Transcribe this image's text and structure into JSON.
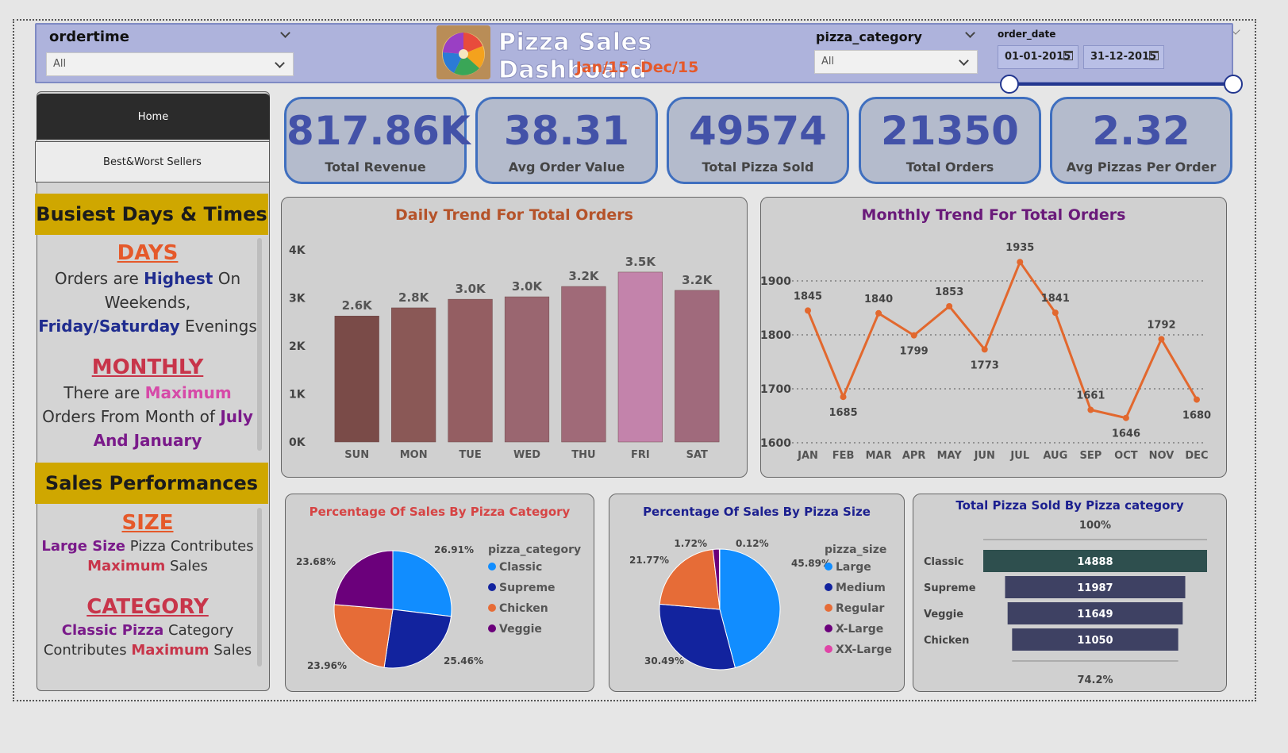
{
  "header": {
    "title": "Pizza Sales Dashboard",
    "subtitle": "Jan/15 -Dec/15",
    "ordertime": {
      "label": "ordertime",
      "value": "All"
    },
    "pizza_category": {
      "label": "pizza_category",
      "value": "All"
    },
    "order_date": {
      "label": "order_date",
      "start": "01-01-2015",
      "end": "31-12-2015"
    }
  },
  "nav": {
    "home": "Home",
    "best_worst": "Best&Worst Sellers"
  },
  "sidebar": {
    "busiest_title": "Busiest Days & Times",
    "days_heading": "DAYS",
    "days_text": {
      "a": "Orders are ",
      "b": "Highest",
      "c": " On Weekends, ",
      "d": "Friday/Saturday",
      "e": " Evenings"
    },
    "monthly_heading": "MONTHLY",
    "monthly_text": {
      "a": "There are ",
      "b": "Maximum",
      "c": " Orders From Month of ",
      "d": "July And January"
    },
    "sales_title": "Sales Performances",
    "size_heading": "SIZE",
    "size_text": {
      "a": "Large Size",
      "b": " Pizza Contributes ",
      "c": "Maximum",
      "d": " Sales"
    },
    "category_heading": "CATEGORY",
    "category_text": {
      "a": "Classic Pizza",
      "b": " Category Contributes ",
      "c": "Maximum",
      "d": " Sales"
    }
  },
  "kpis": [
    {
      "value": "817.86K",
      "label": "Total Revenue"
    },
    {
      "value": "38.31",
      "label": "Avg Order Value"
    },
    {
      "value": "49574",
      "label": "Total Pizza Sold"
    },
    {
      "value": "21350",
      "label": "Total Orders"
    },
    {
      "value": "2.32",
      "label": "Avg Pizzas Per Order"
    }
  ],
  "colors": {
    "accent_blue": "#4352a8",
    "orange": "#e5592a",
    "gold": "#cfa700",
    "line": "#e2682e",
    "daily_title": "#b5532a",
    "monthly_title": "#6a1a7a"
  },
  "chart_data": [
    {
      "type": "bar",
      "title": "Daily Trend For Total Orders",
      "categories": [
        "SUN",
        "MON",
        "TUE",
        "WED",
        "THU",
        "FRI",
        "SAT"
      ],
      "values": [
        2624,
        2794,
        2973,
        3024,
        3239,
        3538,
        3158
      ],
      "data_labels": [
        "2.6K",
        "2.8K",
        "3.0K",
        "3.0K",
        "3.2K",
        "3.5K",
        "3.2K"
      ],
      "yticks": [
        "0K",
        "1K",
        "2K",
        "3K",
        "4K"
      ],
      "ylim": [
        0,
        4000
      ],
      "colors": [
        "#7a4b48",
        "#8a5856",
        "#945e62",
        "#9a6670",
        "#a06a78",
        "#c383ab",
        "#a06a7c"
      ]
    },
    {
      "type": "line",
      "title": "Monthly Trend For Total Orders",
      "categories": [
        "JAN",
        "FEB",
        "MAR",
        "APR",
        "MAY",
        "JUN",
        "JUL",
        "AUG",
        "SEP",
        "OCT",
        "NOV",
        "DEC"
      ],
      "values": [
        1845,
        1685,
        1840,
        1799,
        1853,
        1773,
        1935,
        1841,
        1661,
        1646,
        1792,
        1680
      ],
      "yticks": [
        "1600",
        "1700",
        "1800",
        "1900"
      ],
      "ylim": [
        1600,
        1950
      ],
      "grid": true
    },
    {
      "type": "pie",
      "title": "Percentage Of Sales By Pizza Category",
      "legend_title": "pizza_category",
      "labels": [
        "Classic",
        "Supreme",
        "Chicken",
        "Veggie"
      ],
      "values": [
        26.91,
        25.46,
        23.96,
        23.68
      ],
      "pct_labels": [
        "26.91%",
        "25.46%",
        "23.96%",
        "23.68%"
      ],
      "colors": [
        "#118dff",
        "#12239e",
        "#e66c37",
        "#6b007b"
      ]
    },
    {
      "type": "pie",
      "title": "Percentage Of Sales By Pizza Size",
      "legend_title": "pizza_size",
      "labels": [
        "Large",
        "Medium",
        "Regular",
        "X-Large",
        "XX-Large"
      ],
      "values": [
        45.89,
        30.49,
        21.77,
        1.72,
        0.12
      ],
      "pct_labels": [
        "45.89%",
        "30.49%",
        "21.77%",
        "1.72%",
        "0.12%"
      ],
      "colors": [
        "#118dff",
        "#12239e",
        "#e66c37",
        "#6b007b",
        "#e044a7"
      ]
    },
    {
      "type": "bar",
      "title": "Total Pizza Sold By Pizza category",
      "categories": [
        "Classic",
        "Supreme",
        "Veggie",
        "Chicken"
      ],
      "values": [
        14888,
        11987,
        11649,
        11050
      ],
      "top_label": "100%",
      "bottom_label": "74.2%",
      "colors": [
        "#2e4f4e",
        "#3e4163",
        "#3e4163",
        "#3e4163"
      ]
    }
  ]
}
